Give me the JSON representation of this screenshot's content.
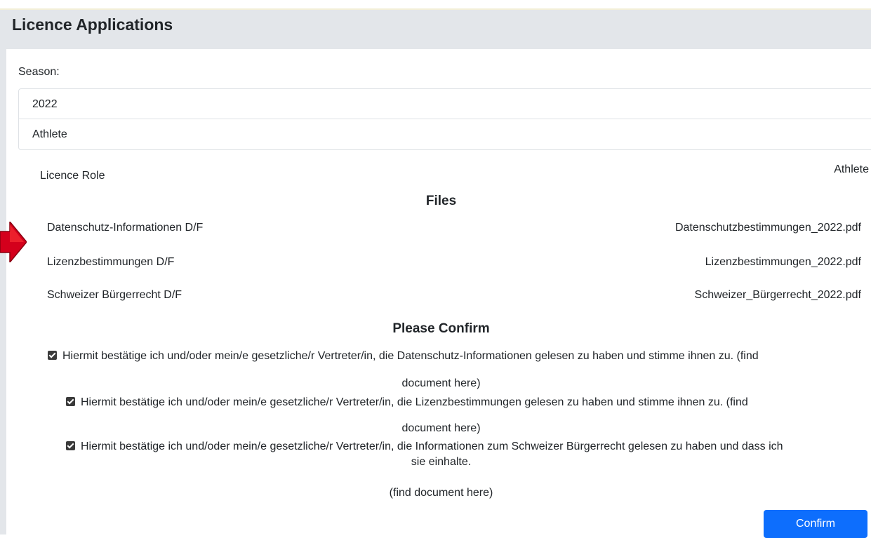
{
  "page": {
    "title": "Licence Applications"
  },
  "form": {
    "season_label": "Season:",
    "season_value": "2022",
    "type_value": "Athlete"
  },
  "licence_role": {
    "label": "Licence Role",
    "value": "Athlete"
  },
  "files": {
    "title": "Files",
    "items": [
      {
        "name": "Datenschutz-Informationen D/F",
        "file": "Datenschutzbestimmungen_2022.pdf"
      },
      {
        "name": "Lizenzbestimmungen D/F",
        "file": "Lizenzbestimmungen_2022.pdf"
      },
      {
        "name": "Schweizer Bürgerrecht D/F",
        "file": "Schweizer_Bürgerrecht_2022.pdf"
      }
    ]
  },
  "confirm": {
    "title": "Please Confirm",
    "items": [
      {
        "checked": true,
        "text": "Hiermit bestätige ich und/oder mein/e gesetzliche/r Vertreter/in, die Datenschutz-Informationen gelesen zu haben und stimme ihnen zu. (find",
        "text2": "document here)"
      },
      {
        "checked": true,
        "text": "Hiermit bestätige ich und/oder mein/e gesetzliche/r Vertreter/in, die Lizenzbestimmungen gelesen zu haben und stimme ihnen zu. (find",
        "text2": "document here)"
      },
      {
        "checked": true,
        "text": "Hiermit bestätige ich und/oder mein/e gesetzliche/r Vertreter/in, die Informationen zum Schweizer Bürgerrecht gelesen zu haben und dass ich",
        "text2": "sie einhalte.",
        "text3": "(find document here)"
      }
    ],
    "button_label": "Confirm"
  },
  "colors": {
    "primary": "#0d6efd",
    "header_bg": "#e3e6ea",
    "annotation_arrow": "#d4001c"
  }
}
